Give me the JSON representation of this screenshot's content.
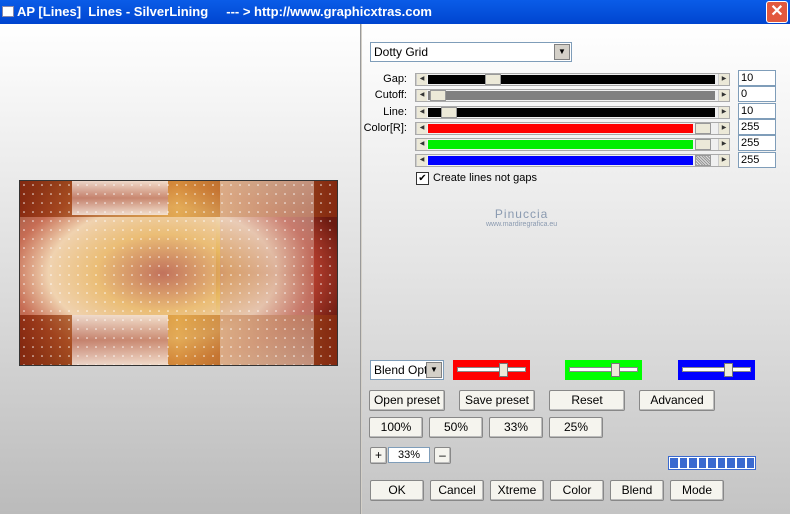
{
  "window": {
    "title": "AP [Lines]  Lines - SilverLining     --- > http://www.graphicxtras.com"
  },
  "preset_select": {
    "value": "Dotty Grid"
  },
  "params": [
    {
      "label": "Gap:",
      "value": "10",
      "track_color": "#000000"
    },
    {
      "label": "Cutoff:",
      "value": "0",
      "track_color": "#808080"
    },
    {
      "label": "Line:",
      "value": "10",
      "track_color": "#000000"
    },
    {
      "label": "Color[R]:",
      "value": "255",
      "track_color": "#ff0000"
    },
    {
      "label": "",
      "value": "255",
      "track_color": "#00ee00"
    },
    {
      "label": "",
      "value": "255",
      "track_color": "#0000ff"
    }
  ],
  "checkbox": {
    "label": "Create lines not gaps",
    "checked": true,
    "mark": "✔"
  },
  "watermark": {
    "line1": "Pinuccia",
    "line2": "www.mardiregrafica.eu"
  },
  "blend_select": {
    "value": "Blend Optio"
  },
  "color_panels": [
    {
      "color": "#ff0000"
    },
    {
      "color": "#00ff00"
    },
    {
      "color": "#0000ff"
    }
  ],
  "buttons": {
    "open_preset": "Open preset",
    "save_preset": "Save preset",
    "reset": "Reset",
    "advanced": "Advanced",
    "zoom100": "100%",
    "zoom50": "50%",
    "zoom33": "33%",
    "zoom25": "25%",
    "plus": "+",
    "minus": "–",
    "ok": "OK",
    "cancel": "Cancel",
    "xtreme": "Xtreme",
    "color": "Color",
    "blend": "Blend",
    "mode": "Mode"
  },
  "zoom": {
    "value": "33%"
  },
  "icons": {
    "close": "close-icon",
    "window": "window-icon",
    "dropdown": "chevron-down-icon"
  }
}
